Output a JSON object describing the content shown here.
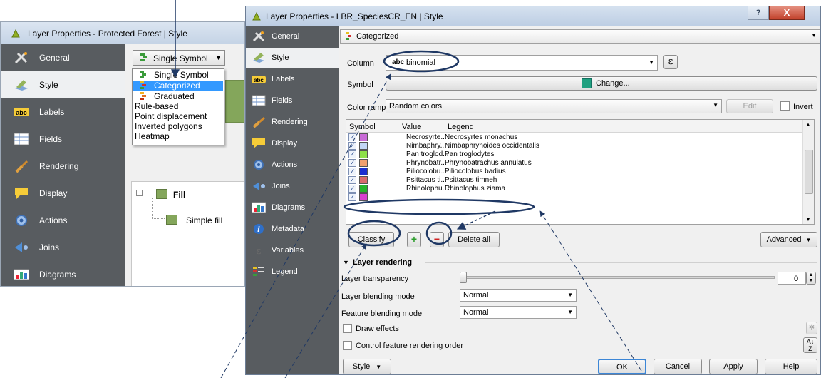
{
  "back_window": {
    "title": "Layer Properties - Protected Forest | Style",
    "sidebar": [
      {
        "label": "General",
        "icon": "general-icon"
      },
      {
        "label": "Style",
        "icon": "style-icon"
      },
      {
        "label": "Labels",
        "icon": "labels-icon"
      },
      {
        "label": "Fields",
        "icon": "fields-icon"
      },
      {
        "label": "Rendering",
        "icon": "rendering-icon"
      },
      {
        "label": "Display",
        "icon": "display-icon"
      },
      {
        "label": "Actions",
        "icon": "actions-icon"
      },
      {
        "label": "Joins",
        "icon": "joins-icon"
      },
      {
        "label": "Diagrams",
        "icon": "diagrams-icon"
      }
    ],
    "selected_sidebar": "Style",
    "renderer_combo": "Single Symbol",
    "renderer_options": [
      "Single Symbol",
      "Categorized",
      "Graduated",
      "Rule-based",
      "Point displacement",
      "Inverted polygons",
      "Heatmap"
    ],
    "renderer_highlighted": "Categorized",
    "tree": {
      "fill": "Fill",
      "simple_fill": "Simple fill"
    },
    "labels_badge": "abc"
  },
  "front_window": {
    "title": "Layer Properties - LBR_SpeciesCR_EN | Style",
    "help_glyph": "?",
    "close_glyph": "X",
    "sidebar": [
      {
        "label": "General",
        "icon": "general-icon"
      },
      {
        "label": "Style",
        "icon": "style-icon"
      },
      {
        "label": "Labels",
        "icon": "labels-icon"
      },
      {
        "label": "Fields",
        "icon": "fields-icon"
      },
      {
        "label": "Rendering",
        "icon": "rendering-icon"
      },
      {
        "label": "Display",
        "icon": "display-icon"
      },
      {
        "label": "Actions",
        "icon": "actions-icon"
      },
      {
        "label": "Joins",
        "icon": "joins-icon"
      },
      {
        "label": "Diagrams",
        "icon": "diagrams-icon"
      },
      {
        "label": "Metadata",
        "icon": "metadata-icon"
      },
      {
        "label": "Variables",
        "icon": "variables-icon"
      },
      {
        "label": "Legend",
        "icon": "legend-icon"
      }
    ],
    "selected_sidebar": "Style",
    "renderer": "Categorized",
    "column_label": "Column",
    "column_type": "abc",
    "column_value": "binomial",
    "expression_glyph": "ε",
    "symbol_label": "Symbol",
    "change_label": "Change...",
    "color_ramp_label": "Color ramp",
    "color_ramp_value": "Random colors",
    "edit_label": "Edit",
    "invert_label": "Invert",
    "table": {
      "headers": [
        "Symbol",
        "Value",
        "Legend"
      ],
      "rows": [
        {
          "value": "Necrosyrte...",
          "legend": "Necrosyrtes monachus",
          "color": "#c86ad6"
        },
        {
          "value": "Nimbaphry...",
          "legend": "Nimbaphrynoides occidentalis",
          "color": "#c3d6f5"
        },
        {
          "value": "Pan troglod...",
          "legend": "Pan troglodytes",
          "color": "#8ee04a"
        },
        {
          "value": "Phrynobatr...",
          "legend": "Phrynobatrachus annulatus",
          "color": "#f0a070"
        },
        {
          "value": "Piliocolobu...",
          "legend": "Piliocolobus badius",
          "color": "#1a2fd0"
        },
        {
          "value": "Psittacus ti...",
          "legend": "Psittacus timneh",
          "color": "#d96b6b"
        },
        {
          "value": "Rhinolophu...",
          "legend": "Rhinolophus ziama",
          "color": "#26b52b"
        },
        {
          "value": "",
          "legend": "",
          "color": "#d93fd0"
        }
      ]
    },
    "classify_label": "Classify",
    "add_glyph": "+",
    "remove_glyph": "−",
    "delete_all_label": "Delete all",
    "advanced_label": "Advanced",
    "layer_rendering_label": "Layer rendering",
    "transparency_label": "Layer transparency",
    "transparency_value": "0",
    "transparency_level": 0,
    "layer_blending_label": "Layer blending mode",
    "layer_blending_value": "Normal",
    "feature_blending_label": "Feature blending mode",
    "feature_blending_value": "Normal",
    "draw_effects_label": "Draw effects",
    "control_order_label": "Control feature rendering order",
    "style_label": "Style",
    "ok_label": "OK",
    "cancel_label": "Cancel",
    "apply_label": "Apply",
    "help_label": "Help"
  },
  "colors": {
    "sidebar_bg": "#585c60",
    "selection": "#3399ff",
    "fill_green": "#84a65b",
    "annotation": "#1f3864"
  }
}
